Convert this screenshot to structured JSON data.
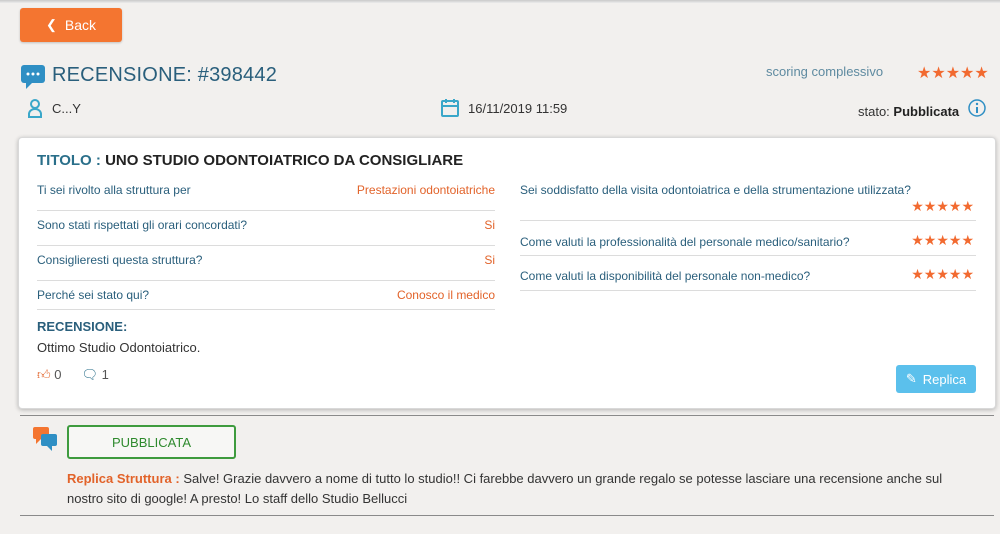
{
  "back_button": {
    "label": "Back"
  },
  "review": {
    "title_prefix": "RECENSIONE: ",
    "id": "#398442",
    "scoring_label": "scoring complessivo",
    "overall_stars": "★★★★★",
    "user": "C...Y",
    "datetime": "16/11/2019 11:59",
    "status_label": "stato:",
    "status_value": "Pubblicata"
  },
  "card": {
    "title_label": "TITOLO :",
    "title_text": "UNO STUDIO ODONTOIATRICO DA CONSIGLIARE",
    "left_questions": [
      {
        "q": "Ti sei rivolto alla struttura per",
        "a": "Prestazioni odontoiatriche"
      },
      {
        "q": "Sono stati rispettati gli orari concordati?",
        "a": "Si"
      },
      {
        "q": "Consiglieresti questa struttura?",
        "a": "Si"
      },
      {
        "q": "Perché sei stato qui?",
        "a": "Conosco il medico"
      }
    ],
    "right_questions": [
      {
        "q": "Sei soddisfatto della visita odontoiatrica e della strumentazione utilizzata?",
        "stars": "★★★★★",
        "rating": 5
      },
      {
        "q": "Come valuti la professionalità del personale medico/sanitario?",
        "stars": "★★★★★",
        "rating": 5
      },
      {
        "q": "Come valuti la disponibilità del personale non-medico?",
        "stars": "★★★★★",
        "rating": 5
      }
    ],
    "review_label": "RECENSIONE:",
    "review_text": "Ottimo Studio Odontoiatrico.",
    "likes": "0",
    "comments": "1",
    "reply_button": "Replica"
  },
  "reply": {
    "status_button": "PUBBLICATA",
    "label": "Replica Struttura :",
    "text": "Salve! Grazie davvero a nome di tutto lo studio!! Ci farebbe davvero un grande regalo se potesse lasciare una recensione anche sul nostro sito di google! A presto! Lo staff dello Studio Bellucci"
  },
  "colors": {
    "accent": "#f47530",
    "primary_text": "#2a5f7c",
    "reply_button": "#5bc0ec",
    "published": "#3e9b3e"
  }
}
